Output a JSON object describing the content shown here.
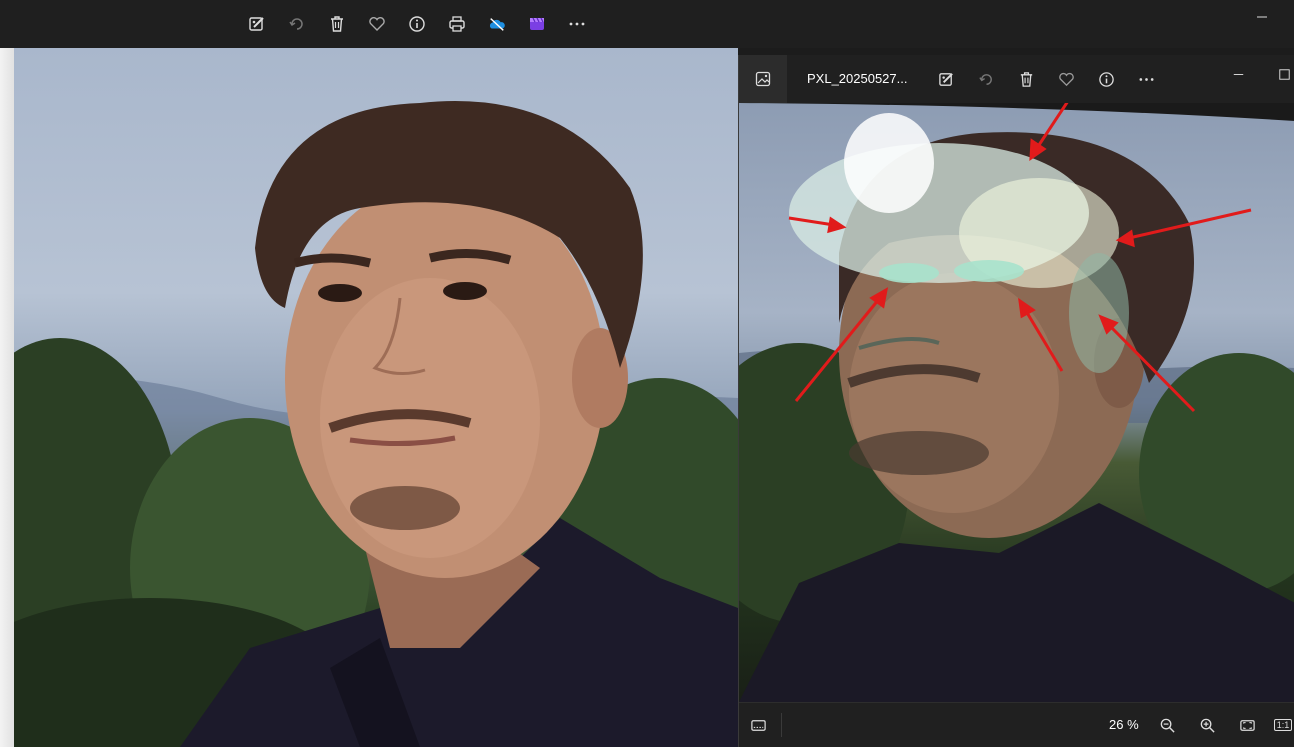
{
  "main_toolbar": {
    "icons": [
      "edit-image-icon",
      "rotate-icon",
      "delete-icon",
      "favorite-heart-icon",
      "info-icon",
      "print-icon",
      "onedrive-icon",
      "clipchamp-icon",
      "more-options-icon"
    ]
  },
  "viewer": {
    "title": "PXL_20250527...",
    "zoom_label": "26 %",
    "actual_size_label": "1:1"
  },
  "colors": {
    "toolbar_bg": "#1f1f1f",
    "annotation_arrow": "#e11b1b",
    "onedrive_blue": "#1e8fe1"
  }
}
